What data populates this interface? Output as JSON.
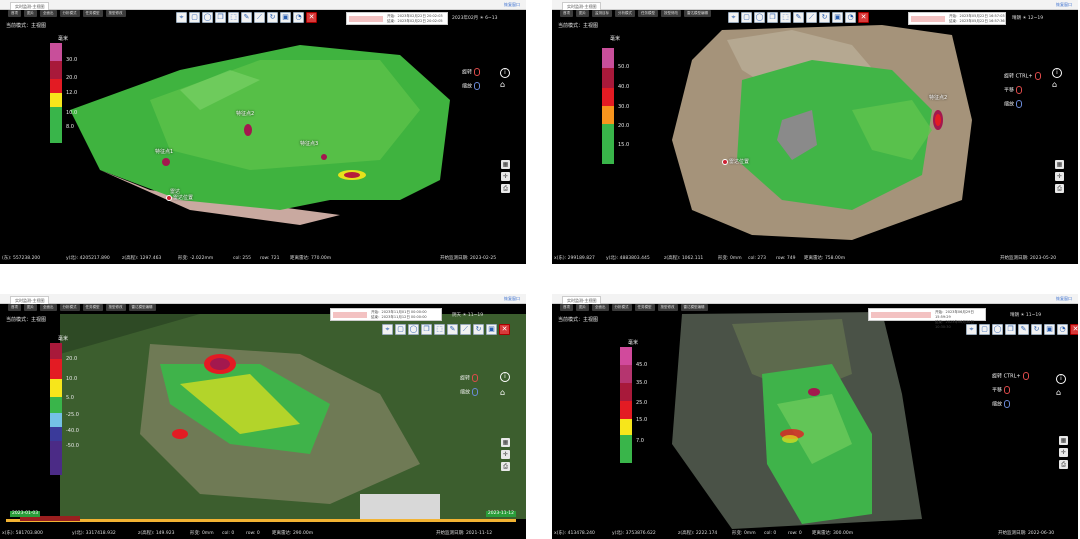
{
  "panels": [
    {
      "tab": "实时监测-主视图",
      "link": "恢复窗口",
      "menu": [
        "首项",
        "图片",
        "全面出",
        "分析模式",
        "任务模型",
        "按型修改",
        "按出修改"
      ],
      "mode": "当前模式：主视图",
      "toolbar_icons": [
        "location-icon",
        "rectangle-icon",
        "circle-icon",
        "copy-icon",
        "edit-icon",
        "ruler-icon",
        "rotate-icon",
        "frame-icon",
        "monitor-icon",
        "delete-icon"
      ],
      "info": {
        "t1": "开始：2023年02月22日 20:02:03",
        "t2": "结束：2023年02月22日 20:02:05"
      },
      "weather": "2023年02月 ☀ 6~13",
      "legend": {
        "unit": "毫米",
        "labels": [
          "30.0",
          "20.0",
          "12.0",
          "10.0",
          "8.0"
        ],
        "colors": [
          "#c84f9a",
          "#a8193a",
          "#e31b23",
          "#f7e61b",
          "#39b54a"
        ]
      },
      "controls": [
        "旋转",
        "缩放"
      ],
      "markers": [
        "特征点1",
        "特征点2",
        "特征点3",
        "雷达",
        "雷达位置"
      ],
      "status": [
        "(东): 557238.200",
        "y(北): 4205217.890",
        "z(高程): 1297.463",
        "形变: -2.022mm",
        "col: 255",
        "row: 721",
        "距离雷达: 770.00m",
        "开始监测日期: 2023-02-25"
      ]
    },
    {
      "tab": "实时监测-主视图",
      "link": "恢复窗口",
      "menu": [
        "首项",
        "图片",
        "监测目标",
        "分析模式",
        "任务模型",
        "按型修改",
        "雷达模型编辑"
      ],
      "mode": "当前模式：主视图",
      "info": {
        "t1": "开始：2023年05月22日 16:57:03",
        "t2": "结束：2023年05月22日 16:57:36"
      },
      "weather": "晴朗 ☀ 12~19",
      "legend": {
        "unit": "毫米",
        "labels": [
          "50.0",
          "40.0",
          "30.0",
          "20.0",
          "15.0"
        ],
        "colors": [
          "#c84f9a",
          "#a8193a",
          "#e31b23",
          "#f7941d",
          "#39b54a"
        ]
      },
      "controls": [
        "旋转",
        "CTRL+",
        "平移",
        "缩放"
      ],
      "markers": [
        "特征点2",
        "雷达位置"
      ],
      "status": [
        "x(东): 299189.827",
        "y(北): 4883803.445",
        "z(高程): 1062.111",
        "形变: 0mm",
        "col: 273",
        "row: 749",
        "距离雷达: 758.00m",
        "开始监测日期: 2023-05-20"
      ]
    },
    {
      "tab": "实时监测-主视图",
      "link": "恢复窗口",
      "menu": [
        "首项",
        "图片",
        "全面出",
        "分析模式",
        "任务模型",
        "按型修改",
        "雷达模型编辑"
      ],
      "mode": "当前模式：主视图",
      "info": {
        "t1": "开始：2023年11月01日 00:00:00",
        "t2": "结束：2023年11月12日 00:00:00"
      },
      "weather": "阴天 ☀ 11~19",
      "legend": {
        "unit": "毫米",
        "labels": [
          "20.0",
          "10.0",
          "5.0",
          "-25.0",
          "-40.0",
          "-50.0"
        ],
        "colors": [
          "#a8193a",
          "#e31b23",
          "#f7e61b",
          "#39b54a",
          "#74c1e6",
          "#3a3a9a",
          "#4b2b86"
        ]
      },
      "controls": [
        "旋转",
        "缩放"
      ],
      "timeline": {
        "start": "2023-01-03",
        "end": "2023-11-12"
      },
      "status": [
        "x(东): 581703.800",
        "y(北): 3317418.932",
        "z(高程): 149.923",
        "形变: 0mm",
        "col: 0",
        "row: 0",
        "距离雷达: 290.00m",
        "开始监测日期: 2021-11-12"
      ]
    },
    {
      "tab": "实时监测-主视图",
      "link": "恢复窗口",
      "menu": [
        "首项",
        "图片",
        "全面出",
        "分析模式",
        "任务模型",
        "按型修改",
        "雷达模型编辑"
      ],
      "mode": "当前模式：主视图",
      "info": {
        "t1": "开始：2023年06月29日 15:59:29",
        "t2": "结束：2023年06月30日 10:30:30"
      },
      "weather": "晴朗 ☀ 11~19",
      "legend": {
        "unit": "毫米",
        "labels": [
          "45.0",
          "35.0",
          "25.0",
          "15.0",
          "7.0"
        ],
        "colors": [
          "#d14a9c",
          "#a8193a",
          "#a8193a",
          "#e31b23",
          "#f7e61b",
          "#39b54a"
        ]
      },
      "controls": [
        "旋转",
        "CTRL+",
        "平移",
        "缩放"
      ],
      "status": [
        "x(东): 413478.240",
        "y(北): 3753876.622",
        "z(高程): 2222.174",
        "形变: 0mm",
        "col: 0",
        "row: 0",
        "距离雷达: 300.00m",
        "开始监测日期: 2022-06-30"
      ]
    }
  ]
}
